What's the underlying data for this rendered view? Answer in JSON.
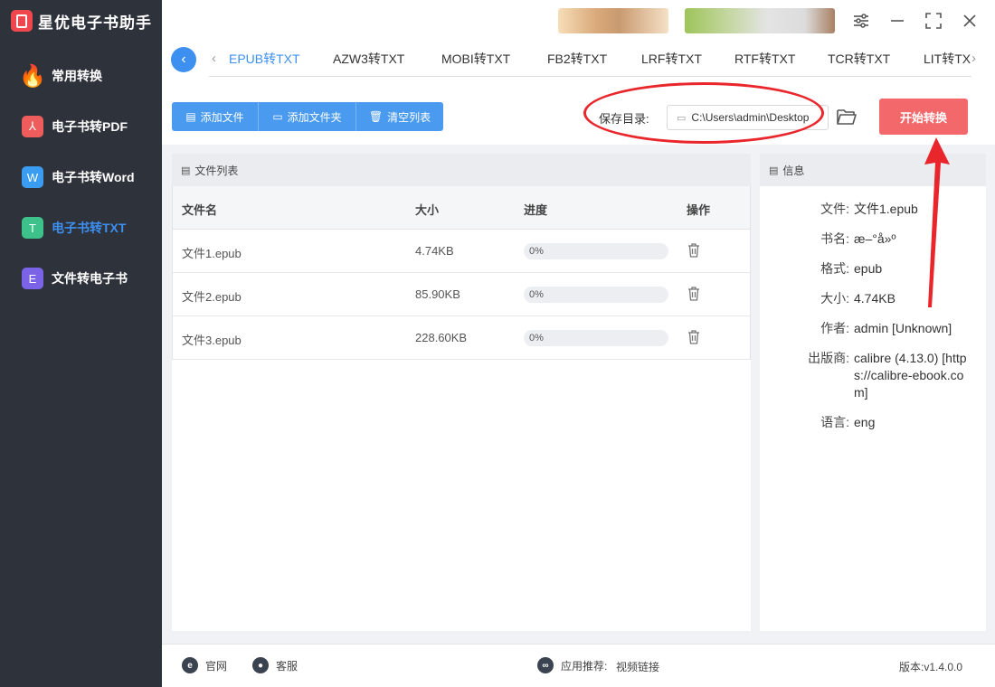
{
  "app": {
    "title": "星优电子书助手"
  },
  "sidebar": {
    "items": [
      {
        "label": "常用转换",
        "icon": "fire-icon",
        "glyph": "🔥",
        "color": "transparent"
      },
      {
        "label": "电子书转PDF",
        "icon": "pdf-icon",
        "glyph": "⅄",
        "color": "#ee5c5c"
      },
      {
        "label": "电子书转Word",
        "icon": "word-icon",
        "glyph": "W",
        "color": "#3b9df2"
      },
      {
        "label": "电子书转TXT",
        "icon": "txt-icon",
        "glyph": "T",
        "color": "#3cc28a",
        "active": true
      },
      {
        "label": "文件转电子书",
        "icon": "ebook-icon",
        "glyph": "E",
        "color": "#7a63e6"
      }
    ]
  },
  "tabs": {
    "items": [
      "EPUB转TXT",
      "AZW3转TXT",
      "MOBI转TXT",
      "FB2转TXT",
      "LRF转TXT",
      "RTF转TXT",
      "TCR转TXT",
      "LIT转TXT"
    ],
    "active_index": 0
  },
  "toolbar": {
    "add_file": "添加文件",
    "add_folder": "添加文件夹",
    "clear_list": "清空列表",
    "save_label": "保存目录:",
    "save_path": "C:\\Users\\admin\\Desktop",
    "start": "开始转换"
  },
  "file_list": {
    "title": "文件列表",
    "columns": {
      "name": "文件名",
      "size": "大小",
      "progress": "进度",
      "action": "操作"
    },
    "rows": [
      {
        "name": "文件1.epub",
        "size": "4.74KB",
        "progress": 0,
        "progress_text": "0%"
      },
      {
        "name": "文件2.epub",
        "size": "85.90KB",
        "progress": 0,
        "progress_text": "0%"
      },
      {
        "name": "文件3.epub",
        "size": "228.60KB",
        "progress": 0,
        "progress_text": "0%"
      }
    ]
  },
  "info": {
    "title": "信息",
    "rows": [
      {
        "key": "文件:",
        "value": "文件1.epub"
      },
      {
        "key": "书名:",
        "value": "æ–°å»º"
      },
      {
        "key": "格式:",
        "value": "epub"
      },
      {
        "key": "大小:",
        "value": "4.74KB"
      },
      {
        "key": "作者:",
        "value": "admin [Unknown]"
      },
      {
        "key": "出版商:",
        "value": "calibre (4.13.0) [https://calibre-ebook.com]"
      },
      {
        "key": "语言:",
        "value": "eng"
      }
    ]
  },
  "footer": {
    "website": "官网",
    "service": "客服",
    "recommend_label": "应用推荐:",
    "recommend_link": "视频链接",
    "version": "版本:v1.4.0.0"
  },
  "colors": {
    "accent": "#3d8ff0",
    "start": "#f2686b",
    "sidebar": "#2e323b",
    "annotation": "#e8262b"
  }
}
